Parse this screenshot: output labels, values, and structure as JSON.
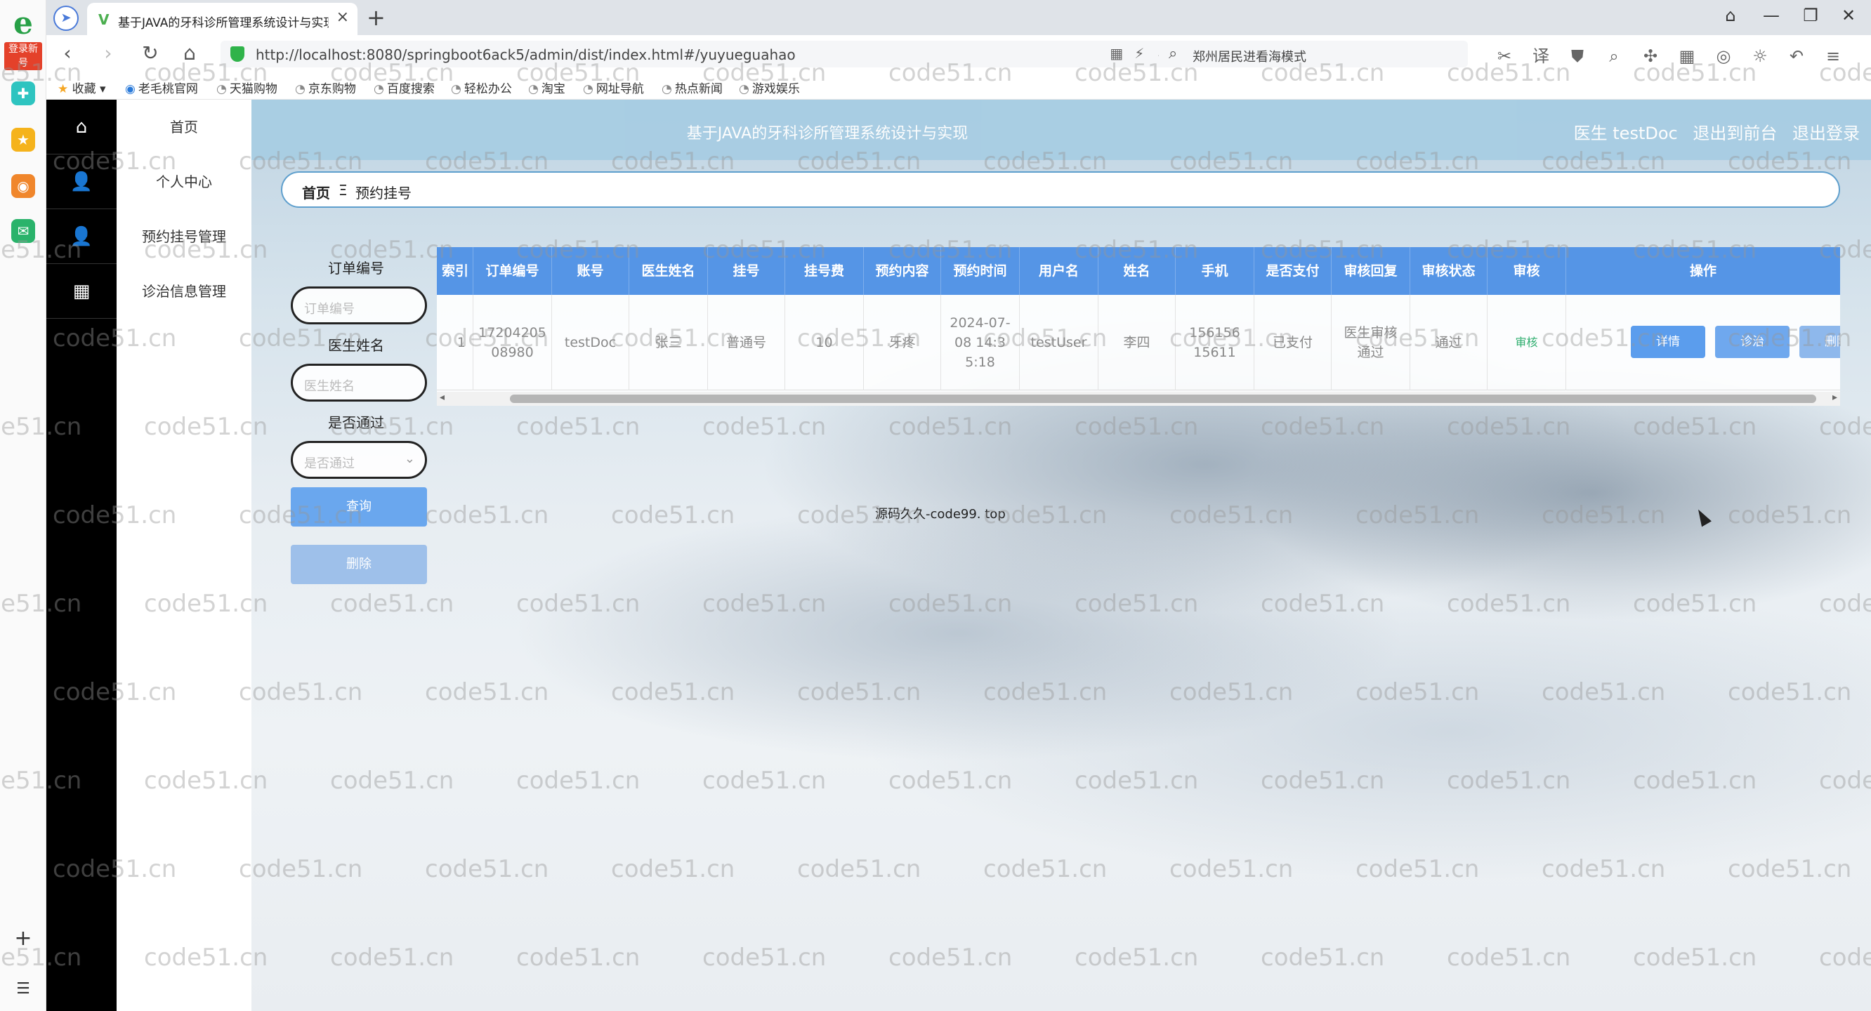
{
  "browser": {
    "rail_badge": "登录新号",
    "tab_title": "基于JAVA的牙科诊所管理系统设计与实现",
    "url": "http://localhost:8080/springboot6ack5/admin/dist/index.html#/yuyueguahao",
    "search_placeholder": "郑州居民进看海模式",
    "bookmarks": [
      "收藏",
      "老毛桃官网",
      "天猫购物",
      "京东购物",
      "百度搜索",
      "轻松办公",
      "淘宝",
      "网址导航",
      "热点新闻",
      "游戏娱乐"
    ]
  },
  "app": {
    "header_title": "基于JAVA的牙科诊所管理系统设计与实现",
    "user_label": "医生 testDoc",
    "to_front": "退出到前台",
    "logout": "退出登录",
    "menu": [
      "首页",
      "个人中心",
      "预约挂号管理",
      "诊治信息管理"
    ],
    "breadcrumb": {
      "home": "首页",
      "sep": "Ξ",
      "current": "预约挂号"
    },
    "search": {
      "order_no_label": "订单编号",
      "order_no_placeholder": "订单编号",
      "doctor_label": "医生姓名",
      "doctor_placeholder": "医生姓名",
      "passed_label": "是否通过",
      "passed_placeholder": "是否通过",
      "query_button": "查询",
      "delete_button": "删除"
    },
    "table": {
      "headers": [
        "索引",
        "订单编号",
        "账号",
        "医生姓名",
        "挂号",
        "挂号费",
        "预约内容",
        "预约时间",
        "用户名",
        "姓名",
        "手机",
        "是否支付",
        "审核回复",
        "审核状态",
        "审核",
        "操作"
      ],
      "rows": [
        {
          "index": "1",
          "order_no": "1720420508980",
          "account": "testDoc",
          "doctor": "张三",
          "reg_type": "普通号",
          "fee": "10",
          "content": "牙疼",
          "time": "2024-07-08 14:35:18",
          "username": "testUser",
          "name": "李四",
          "phone": "15615615611",
          "paid": "已支付",
          "reply": "医生审核通过",
          "status": "通过",
          "audit": "审核",
          "actions": [
            "详情",
            "诊治",
            "删除"
          ]
        }
      ]
    },
    "footer_text": "源码久久-code99. top"
  },
  "watermark": "code51.cn",
  "colors": {
    "header": "#a8cde3",
    "table_head": "#5595e6",
    "btn_blue": "#5b9ded",
    "btn_light": "#8eb8ec",
    "audit_green": "#2fae6f"
  }
}
